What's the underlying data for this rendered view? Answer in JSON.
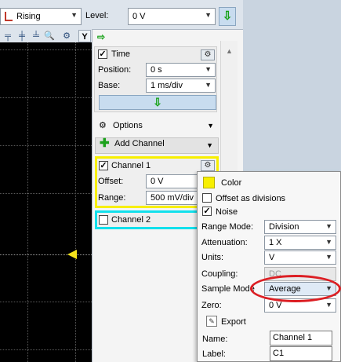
{
  "trigger": {
    "mode": "Rising",
    "level_label": "Level:",
    "level_value": "0 V",
    "apply_icon": "green-down-arrow-icon"
  },
  "scope_toolbar": {
    "y_label": "Y"
  },
  "time": {
    "title": "Time",
    "checked": true,
    "position_label": "Position:",
    "position_value": "0 s",
    "base_label": "Base:",
    "base_value": "1 ms/div",
    "apply_icon": "green-down-arrow-icon"
  },
  "options": {
    "label": "Options"
  },
  "add_channel": {
    "label": "Add Channel"
  },
  "channel1": {
    "label": "Channel 1",
    "checked": true,
    "offset_label": "Offset:",
    "offset_value": "0 V",
    "range_label": "Range:",
    "range_value": "500 mV/div",
    "color": "#f7ef00"
  },
  "channel2": {
    "label": "Channel 2",
    "checked": false,
    "color": "#12e0ec"
  },
  "popup": {
    "color_label": "Color",
    "color_value": "#f7ef00",
    "offset_div_label": "Offset as divisions",
    "offset_div_checked": false,
    "noise_label": "Noise",
    "noise_checked": true,
    "range_mode_label": "Range Mode:",
    "range_mode_value": "Division",
    "attenuation_label": "Attenuation:",
    "attenuation_value": "1 X",
    "units_label": "Units:",
    "units_value": "V",
    "coupling_label": "Coupling:",
    "coupling_value": "DC",
    "sample_mode_label": "Sample Mode",
    "sample_mode_value": "Average",
    "zero_label": "Zero:",
    "zero_value": "0 V",
    "export_label": "Export",
    "name_label": "Name:",
    "name_value": "Channel 1",
    "label_label": "Label:",
    "label_value": "C1"
  },
  "annotation": {
    "color": "#dc1e23"
  }
}
